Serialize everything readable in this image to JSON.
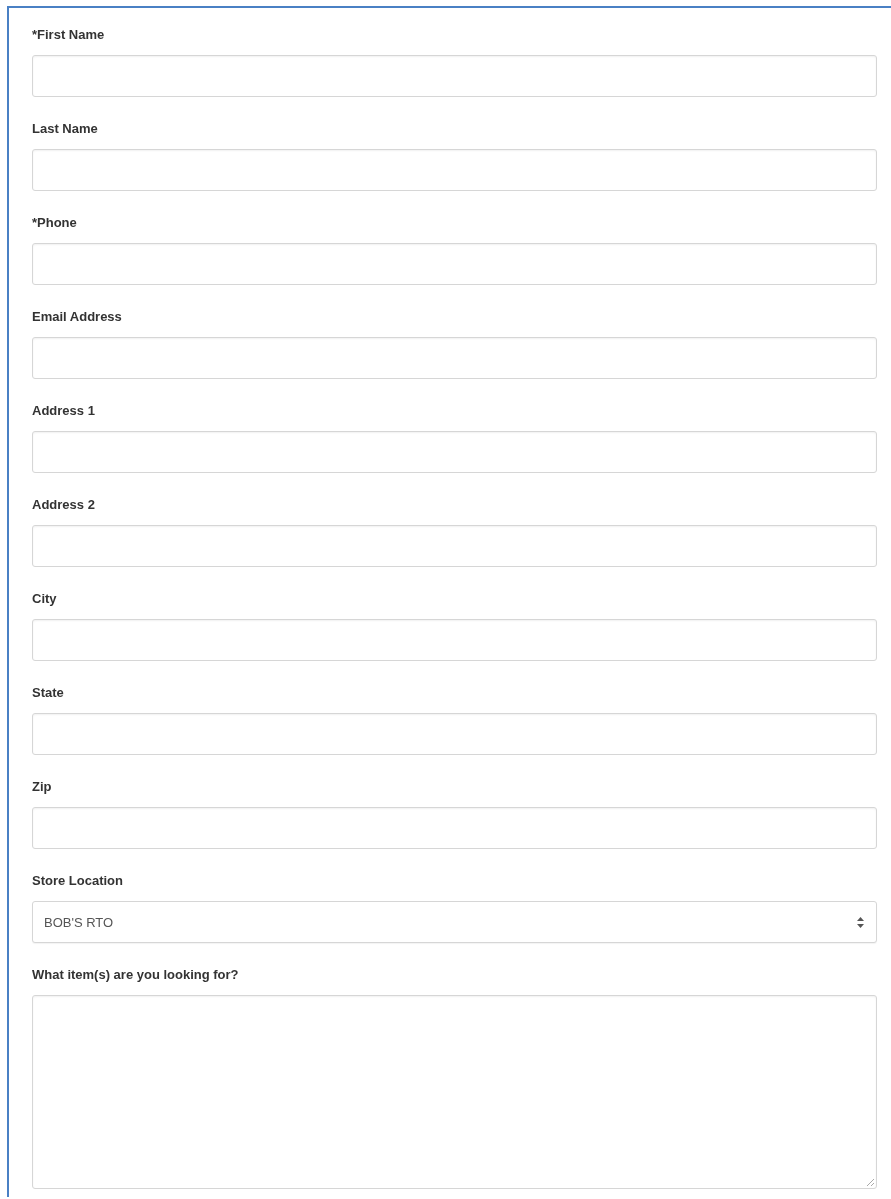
{
  "form": {
    "fields": [
      {
        "kind": "text",
        "label": "*First Name"
      },
      {
        "kind": "text",
        "label": "Last Name"
      },
      {
        "kind": "text",
        "label": "*Phone"
      },
      {
        "kind": "text",
        "label": "Email Address"
      },
      {
        "kind": "text",
        "label": "Address 1"
      },
      {
        "kind": "text",
        "label": "Address 2"
      },
      {
        "kind": "text",
        "label": "City"
      },
      {
        "kind": "text",
        "label": "State"
      },
      {
        "kind": "text",
        "label": "Zip"
      },
      {
        "kind": "select",
        "label": "Store Location",
        "value": "BOB'S RTO"
      },
      {
        "kind": "textarea",
        "label": "What item(s) are you looking for?"
      }
    ]
  }
}
